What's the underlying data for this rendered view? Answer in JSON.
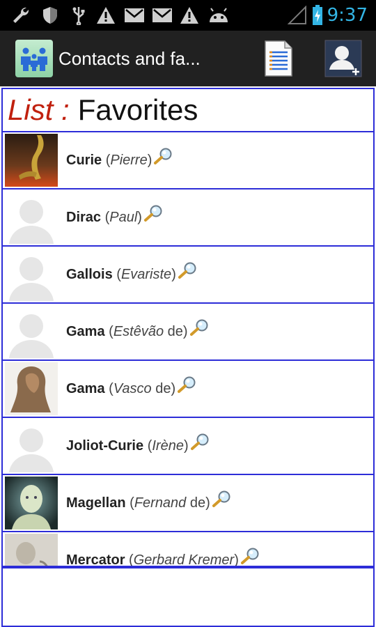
{
  "status_bar": {
    "time": "9:37",
    "icons": [
      "wrench-icon",
      "shield-icon",
      "usb-icon",
      "warning-icon",
      "gmail-icon",
      "gmail-icon",
      "warning-icon",
      "android-icon",
      "signal-icon",
      "battery-charging-icon"
    ],
    "time_color": "#33b5e5"
  },
  "action_bar": {
    "title": "Contacts and fa...",
    "icons": [
      "app-family-icon",
      "document-list-icon",
      "add-contact-icon"
    ]
  },
  "header": {
    "list_label": "List :",
    "list_value": "Favorites",
    "label_color": "#c0200e"
  },
  "contacts": [
    {
      "surname": "Curie",
      "given": "Pierre",
      "suffix": "",
      "avatar": "photo-brass-figure"
    },
    {
      "surname": "Dirac",
      "given": "Paul",
      "suffix": "",
      "avatar": "default-silhouette"
    },
    {
      "surname": "Gallois",
      "given": "Evariste",
      "suffix": "",
      "avatar": "default-silhouette"
    },
    {
      "surname": "Gama",
      "given": "Estêvão",
      "suffix": "de",
      "avatar": "default-silhouette"
    },
    {
      "surname": "Gama",
      "given": "Vasco",
      "suffix": "de",
      "avatar": "photo-bust"
    },
    {
      "surname": "Joliot-Curie",
      "given": "Irène",
      "suffix": "",
      "avatar": "default-silhouette"
    },
    {
      "surname": "Magellan",
      "given": "Fernand",
      "suffix": "de",
      "avatar": "photo-portrait"
    },
    {
      "surname": "Mercator",
      "given": "Gerbard Kremer",
      "suffix": "",
      "avatar": "photo-sketch"
    }
  ],
  "colors": {
    "border": "#2d2dd8",
    "action_bar": "#212121"
  }
}
